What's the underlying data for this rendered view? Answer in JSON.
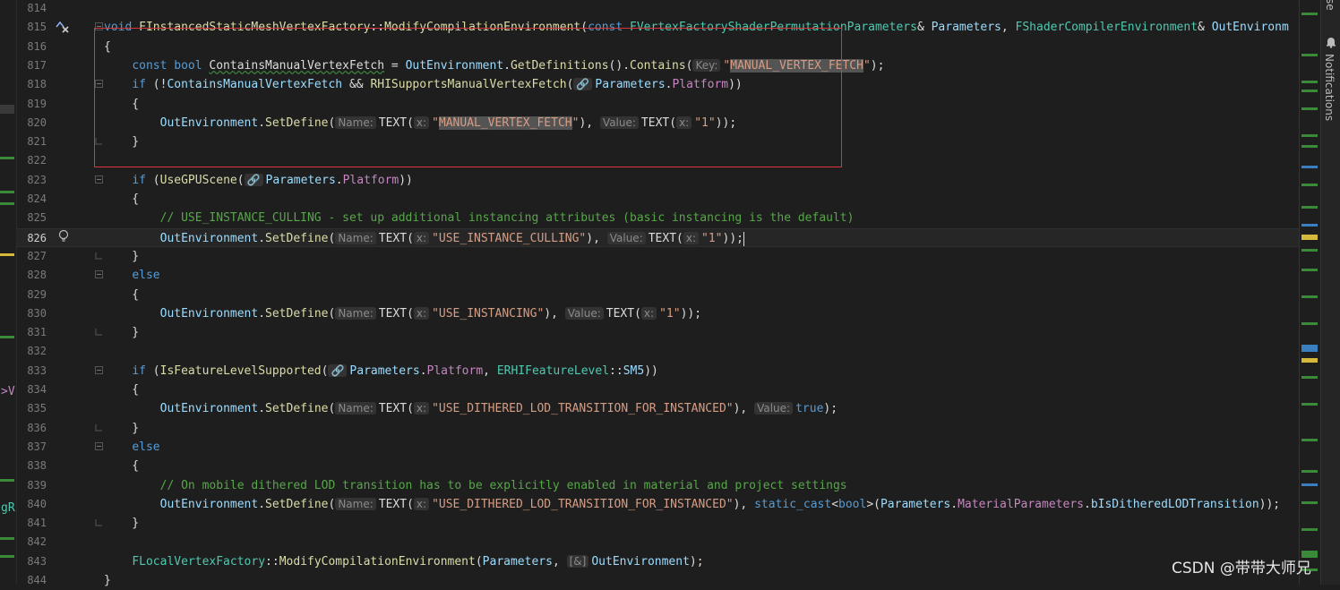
{
  "editor": {
    "left_fragments": [
      ">V",
      "gR"
    ],
    "lines": [
      {
        "n": "814",
        "tokens": []
      },
      {
        "n": "815",
        "tokens": [
          [
            "kw",
            "void "
          ],
          [
            "fn",
            "FInstancedStaticMeshVertexFactory"
          ],
          [
            "pl",
            "::"
          ],
          [
            "fn",
            "ModifyCompilationEnvironment"
          ],
          [
            "pl",
            "("
          ],
          [
            "kw",
            "const "
          ],
          [
            "ty",
            "FVertexFactoryShaderPermutationParameters"
          ],
          [
            "pl",
            "& "
          ],
          [
            "vr",
            "Parameters"
          ],
          [
            "pl",
            ", "
          ],
          [
            "ty",
            "FShaderCompilerEnvironment"
          ],
          [
            "pl",
            "& "
          ],
          [
            "vr",
            "OutEnvironm"
          ]
        ]
      },
      {
        "n": "816",
        "tokens": [
          [
            "pl",
            "{"
          ]
        ]
      },
      {
        "n": "817",
        "tokens": [
          [
            "pl",
            "    "
          ],
          [
            "kw",
            "const bool "
          ],
          [
            "sq",
            "ContainsManualVertexFetch"
          ],
          [
            "pl",
            " = "
          ],
          [
            "vr",
            "OutEnvironment"
          ],
          [
            "pl",
            "."
          ],
          [
            "fn",
            "GetDefinitions"
          ],
          [
            "pl",
            "()."
          ],
          [
            "fn",
            "Contains"
          ],
          [
            "pl",
            "("
          ],
          [
            "hint",
            "Key:"
          ],
          [
            "str",
            "\""
          ],
          [
            "strhl",
            "MANUAL_VERTEX_FETCH"
          ],
          [
            "str",
            "\""
          ],
          [
            "pl",
            ");"
          ]
        ]
      },
      {
        "n": "818",
        "tokens": [
          [
            "pl",
            "    "
          ],
          [
            "kw",
            "if "
          ],
          [
            "pl",
            "(!"
          ],
          [
            "vr",
            "ContainsManualVertexFetch"
          ],
          [
            "pl",
            " && "
          ],
          [
            "fn",
            "RHISupportsManualVertexFetch"
          ],
          [
            "pl",
            "("
          ],
          [
            "hint",
            "🔗"
          ],
          [
            "vr",
            "Parameters"
          ],
          [
            "pl",
            "."
          ],
          [
            "mem",
            "Platform"
          ],
          [
            "pl",
            "))"
          ]
        ]
      },
      {
        "n": "819",
        "tokens": [
          [
            "pl",
            "    {"
          ]
        ]
      },
      {
        "n": "820",
        "tokens": [
          [
            "pl",
            "        "
          ],
          [
            "vr",
            "OutEnvironment"
          ],
          [
            "pl",
            "."
          ],
          [
            "fn",
            "SetDefine"
          ],
          [
            "pl",
            "("
          ],
          [
            "hint",
            "Name:"
          ],
          [
            "pl",
            "TEXT("
          ],
          [
            "hint",
            "x:"
          ],
          [
            "str",
            "\""
          ],
          [
            "strhl",
            "MANUAL_VERTEX_FETCH"
          ],
          [
            "str",
            "\""
          ],
          [
            "pl",
            "), "
          ],
          [
            "hint",
            "Value:"
          ],
          [
            "pl",
            "TEXT("
          ],
          [
            "hint",
            "x:"
          ],
          [
            "str",
            "\"1\""
          ],
          [
            "pl",
            "));"
          ]
        ]
      },
      {
        "n": "821",
        "tokens": [
          [
            "pl",
            "    }"
          ]
        ]
      },
      {
        "n": "822",
        "tokens": []
      },
      {
        "n": "823",
        "tokens": [
          [
            "pl",
            "    "
          ],
          [
            "kw",
            "if "
          ],
          [
            "pl",
            "("
          ],
          [
            "fn",
            "UseGPUScene"
          ],
          [
            "pl",
            "("
          ],
          [
            "hint",
            "🔗"
          ],
          [
            "vr",
            "Parameters"
          ],
          [
            "pl",
            "."
          ],
          [
            "mem",
            "Platform"
          ],
          [
            "pl",
            "))"
          ]
        ]
      },
      {
        "n": "824",
        "tokens": [
          [
            "pl",
            "    {"
          ]
        ]
      },
      {
        "n": "825",
        "tokens": [
          [
            "pl",
            "        "
          ],
          [
            "cm",
            "// USE_INSTANCE_CULLING - set up additional instancing attributes (basic instancing is the default)"
          ]
        ]
      },
      {
        "n": "826",
        "tokens": [
          [
            "pl",
            "        "
          ],
          [
            "vr",
            "OutEnvironment"
          ],
          [
            "pl",
            "."
          ],
          [
            "fn",
            "SetDefine"
          ],
          [
            "pl",
            "("
          ],
          [
            "hint",
            "Name:"
          ],
          [
            "pl",
            "TEXT("
          ],
          [
            "hint",
            "x:"
          ],
          [
            "str",
            "\"USE_INSTANCE_CULLING\""
          ],
          [
            "pl",
            "), "
          ],
          [
            "hint",
            "Value:"
          ],
          [
            "pl",
            "TEXT("
          ],
          [
            "hint",
            "x:"
          ],
          [
            "str",
            "\"1\""
          ],
          [
            "pl",
            "));"
          ],
          [
            "caret",
            ""
          ]
        ]
      },
      {
        "n": "827",
        "tokens": [
          [
            "pl",
            "    }"
          ]
        ]
      },
      {
        "n": "828",
        "tokens": [
          [
            "pl",
            "    "
          ],
          [
            "kw",
            "else"
          ]
        ]
      },
      {
        "n": "829",
        "tokens": [
          [
            "pl",
            "    {"
          ]
        ]
      },
      {
        "n": "830",
        "tokens": [
          [
            "pl",
            "        "
          ],
          [
            "vr",
            "OutEnvironment"
          ],
          [
            "pl",
            "."
          ],
          [
            "fn",
            "SetDefine"
          ],
          [
            "pl",
            "("
          ],
          [
            "hint",
            "Name:"
          ],
          [
            "pl",
            "TEXT("
          ],
          [
            "hint",
            "x:"
          ],
          [
            "str",
            "\"USE_INSTANCING\""
          ],
          [
            "pl",
            "), "
          ],
          [
            "hint",
            "Value:"
          ],
          [
            "pl",
            "TEXT("
          ],
          [
            "hint",
            "x:"
          ],
          [
            "str",
            "\"1\""
          ],
          [
            "pl",
            "));"
          ]
        ]
      },
      {
        "n": "831",
        "tokens": [
          [
            "pl",
            "    }"
          ]
        ]
      },
      {
        "n": "832",
        "tokens": []
      },
      {
        "n": "833",
        "tokens": [
          [
            "pl",
            "    "
          ],
          [
            "kw",
            "if "
          ],
          [
            "pl",
            "("
          ],
          [
            "fn",
            "IsFeatureLevelSupported"
          ],
          [
            "pl",
            "("
          ],
          [
            "hint",
            "🔗"
          ],
          [
            "vr",
            "Parameters"
          ],
          [
            "pl",
            "."
          ],
          [
            "mem",
            "Platform"
          ],
          [
            "pl",
            ", "
          ],
          [
            "ty",
            "ERHIFeatureLevel"
          ],
          [
            "pl",
            "::"
          ],
          [
            "vr",
            "SM5"
          ],
          [
            "pl",
            "))"
          ]
        ]
      },
      {
        "n": "834",
        "tokens": [
          [
            "pl",
            "    {"
          ]
        ]
      },
      {
        "n": "835",
        "tokens": [
          [
            "pl",
            "        "
          ],
          [
            "vr",
            "OutEnvironment"
          ],
          [
            "pl",
            "."
          ],
          [
            "fn",
            "SetDefine"
          ],
          [
            "pl",
            "("
          ],
          [
            "hint",
            "Name:"
          ],
          [
            "pl",
            "TEXT("
          ],
          [
            "hint",
            "x:"
          ],
          [
            "str",
            "\"USE_DITHERED_LOD_TRANSITION_FOR_INSTANCED\""
          ],
          [
            "pl",
            "), "
          ],
          [
            "hint",
            "Value:"
          ],
          [
            "kw",
            "true"
          ],
          [
            "pl",
            ");"
          ]
        ]
      },
      {
        "n": "836",
        "tokens": [
          [
            "pl",
            "    }"
          ]
        ]
      },
      {
        "n": "837",
        "tokens": [
          [
            "pl",
            "    "
          ],
          [
            "kw",
            "else"
          ]
        ]
      },
      {
        "n": "838",
        "tokens": [
          [
            "pl",
            "    {"
          ]
        ]
      },
      {
        "n": "839",
        "tokens": [
          [
            "pl",
            "        "
          ],
          [
            "cm",
            "// On mobile dithered LOD transition has to be explicitly enabled in material and project settings"
          ]
        ]
      },
      {
        "n": "840",
        "tokens": [
          [
            "pl",
            "        "
          ],
          [
            "vr",
            "OutEnvironment"
          ],
          [
            "pl",
            "."
          ],
          [
            "fn",
            "SetDefine"
          ],
          [
            "pl",
            "("
          ],
          [
            "hint",
            "Name:"
          ],
          [
            "pl",
            "TEXT("
          ],
          [
            "hint",
            "x:"
          ],
          [
            "str",
            "\"USE_DITHERED_LOD_TRANSITION_FOR_INSTANCED\""
          ],
          [
            "pl",
            "), "
          ],
          [
            "kw",
            "static_cast"
          ],
          [
            "pl",
            "<"
          ],
          [
            "kw",
            "bool"
          ],
          [
            "pl",
            ">("
          ],
          [
            "vr",
            "Parameters"
          ],
          [
            "pl",
            "."
          ],
          [
            "mem",
            "MaterialParameters"
          ],
          [
            "pl",
            "."
          ],
          [
            "vr",
            "bIsDitheredLODTransition"
          ],
          [
            "pl",
            "));"
          ]
        ]
      },
      {
        "n": "841",
        "tokens": [
          [
            "pl",
            "    }"
          ]
        ]
      },
      {
        "n": "842",
        "tokens": []
      },
      {
        "n": "843",
        "tokens": [
          [
            "pl",
            "    "
          ],
          [
            "ty",
            "FLocalVertexFactory"
          ],
          [
            "pl",
            "::"
          ],
          [
            "fn",
            "ModifyCompilationEnvironment"
          ],
          [
            "pl",
            "("
          ],
          [
            "vr",
            "Parameters"
          ],
          [
            "pl",
            ", "
          ],
          [
            "hint",
            "[&]"
          ],
          [
            "vr",
            "OutEnvironment"
          ],
          [
            "pl",
            ");"
          ]
        ]
      },
      {
        "n": "844",
        "tokens": [
          [
            "pl",
            "}"
          ]
        ]
      }
    ]
  },
  "sidebar": {
    "top_fragment": "se",
    "notifications_label": "Notifications"
  },
  "watermark": "CSDN @带带大师兄",
  "colors": {
    "background": "#1e1e1e",
    "annotation_box": "#d9373c",
    "keyword": "#569cd6",
    "function": "#dcdcaa",
    "type": "#4ec9b0",
    "string": "#d69d85",
    "comment": "#57a64a"
  },
  "icons": [
    "fold-caret-icon",
    "close-icon",
    "lightbulb-icon",
    "bell-icon"
  ]
}
